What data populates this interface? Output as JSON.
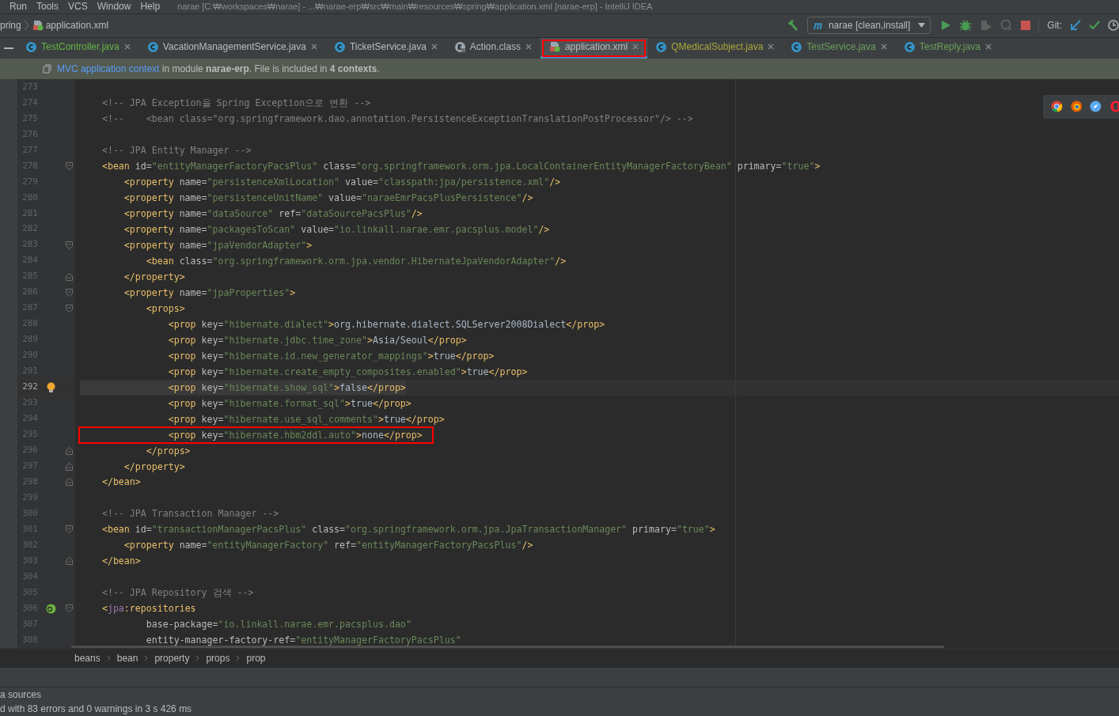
{
  "menu": [
    "Run",
    "Tools",
    "VCS",
    "Window",
    "Help"
  ],
  "window": {
    "title": "narae [C:₩workspaces₩narae] - ...₩narae-erp₩src₩main₩resources₩spring₩application.xml [narae-erp] - IntelliJ IDEA"
  },
  "breadcrumb": {
    "folder": "pring",
    "file": "application.xml"
  },
  "toolbar": {
    "run_config": "narae [clean,install]",
    "git_label": "Git:"
  },
  "tabs": [
    {
      "label": "TestController.java",
      "kind": "class",
      "color": "#62b543",
      "selected": false,
      "highlighted": false
    },
    {
      "label": "VacationManagementService.java",
      "kind": "class",
      "color": "#bbbbbb",
      "selected": false,
      "highlighted": false
    },
    {
      "label": "TicketService.java",
      "kind": "class",
      "color": "#bbbbbb",
      "selected": false,
      "highlighted": false
    },
    {
      "label": "Action.class",
      "kind": "enum",
      "color": "#bbbbbb",
      "selected": false,
      "highlighted": false
    },
    {
      "label": "application.xml",
      "kind": "xml",
      "color": "#bbbbbb",
      "selected": true,
      "highlighted": true
    },
    {
      "label": "QMedicalSubject.java",
      "kind": "class",
      "color": "#a8a83a",
      "selected": false,
      "highlighted": false
    },
    {
      "label": "TestService.java",
      "kind": "class",
      "color": "#6a9f5b",
      "selected": false,
      "highlighted": false
    },
    {
      "label": "TestReply.java",
      "kind": "class",
      "color": "#6a9f5b",
      "selected": false,
      "highlighted": false
    }
  ],
  "notice": {
    "link": "MVC application context",
    "text": " in module **narae-erp**. File is included in **4 contexts**."
  },
  "editor": {
    "lines": [
      {
        "number": "273"
      },
      {
        "number": "274",
        "segments": [
          {
            "kind": "comment",
            "text": "    <!-- JPA Exception을 Spring Exception으로 변환 -->"
          }
        ]
      },
      {
        "number": "275",
        "segments": [
          {
            "kind": "comment",
            "text": "    <!--    <bean class=\"org.springframework.dao.annotation.PersistenceExceptionTranslationPostProcessor\"/> -->"
          }
        ]
      },
      {
        "number": "276"
      },
      {
        "number": "277",
        "segments": [
          {
            "kind": "comment",
            "text": "    <!-- JPA Entity Manager -->"
          }
        ]
      },
      {
        "number": "278",
        "fold_start": true,
        "segments": [
          {
            "kind": "tag",
            "text": "    <bean "
          },
          {
            "kind": "attr",
            "text": "id="
          },
          {
            "kind": "value",
            "text": "\"entityManagerFactoryPacsPlus\""
          },
          {
            "kind": "attr",
            "text": " class="
          },
          {
            "kind": "value",
            "text": "\"org.springframework.orm.jpa.LocalContainerEntityManagerFactoryBean\""
          },
          {
            "kind": "attr",
            "text": " primary="
          },
          {
            "kind": "value",
            "text": "\"true\""
          },
          {
            "kind": "tag",
            "text": ">"
          }
        ]
      },
      {
        "number": "279",
        "segments": [
          {
            "kind": "tag",
            "text": "        <property "
          },
          {
            "kind": "attr",
            "text": "name="
          },
          {
            "kind": "value",
            "text": "\"persistenceXmlLocation\""
          },
          {
            "kind": "attr",
            "text": " value="
          },
          {
            "kind": "value",
            "text": "\"classpath:jpa/persistence.xml\""
          },
          {
            "kind": "tag",
            "text": "/>"
          }
        ]
      },
      {
        "number": "280",
        "segments": [
          {
            "kind": "tag",
            "text": "        <property "
          },
          {
            "kind": "attr",
            "text": "name="
          },
          {
            "kind": "value",
            "text": "\"persistenceUnitName\""
          },
          {
            "kind": "attr",
            "text": " value="
          },
          {
            "kind": "value",
            "text": "\"naraeEmrPacsPlusPersistence\""
          },
          {
            "kind": "tag",
            "text": "/>"
          }
        ]
      },
      {
        "number": "281",
        "segments": [
          {
            "kind": "tag",
            "text": "        <property "
          },
          {
            "kind": "attr",
            "text": "name="
          },
          {
            "kind": "value",
            "text": "\"dataSource\""
          },
          {
            "kind": "attr",
            "text": " ref="
          },
          {
            "kind": "value",
            "text": "\"dataSourcePacsPlus\""
          },
          {
            "kind": "tag",
            "text": "/>"
          }
        ]
      },
      {
        "number": "282",
        "segments": [
          {
            "kind": "tag",
            "text": "        <property "
          },
          {
            "kind": "attr",
            "text": "name="
          },
          {
            "kind": "value",
            "text": "\"packagesToScan\""
          },
          {
            "kind": "attr",
            "text": " value="
          },
          {
            "kind": "value",
            "text": "\"io.linkall.narae.emr.pacsplus.model\""
          },
          {
            "kind": "tag",
            "text": "/>"
          }
        ]
      },
      {
        "number": "283",
        "fold_start": true,
        "segments": [
          {
            "kind": "tag",
            "text": "        <property "
          },
          {
            "kind": "attr",
            "text": "name="
          },
          {
            "kind": "value",
            "text": "\"jpaVendorAdapter\""
          },
          {
            "kind": "tag",
            "text": ">"
          }
        ]
      },
      {
        "number": "284",
        "segments": [
          {
            "kind": "tag",
            "text": "            <bean "
          },
          {
            "kind": "attr",
            "text": "class="
          },
          {
            "kind": "value",
            "text": "\"org.springframework.orm.jpa.vendor.HibernateJpaVendorAdapter\""
          },
          {
            "kind": "tag",
            "text": "/>"
          }
        ]
      },
      {
        "number": "285",
        "fold_end": true,
        "segments": [
          {
            "kind": "tag",
            "text": "        </property>"
          }
        ]
      },
      {
        "number": "286",
        "fold_start": true,
        "segments": [
          {
            "kind": "tag",
            "text": "        <property "
          },
          {
            "kind": "attr",
            "text": "name="
          },
          {
            "kind": "value",
            "text": "\"jpaProperties\""
          },
          {
            "kind": "tag",
            "text": ">"
          }
        ]
      },
      {
        "number": "287",
        "fold_start": true,
        "segments": [
          {
            "kind": "tag",
            "text": "            <props>"
          }
        ]
      },
      {
        "number": "288",
        "segments": [
          {
            "kind": "tag",
            "text": "                <prop "
          },
          {
            "kind": "attr",
            "text": "key="
          },
          {
            "kind": "value",
            "text": "\"hibernate.dialect\""
          },
          {
            "kind": "tag",
            "text": ">"
          },
          {
            "kind": "plain",
            "text": "org.hibernate.dialect.SQLServer2008Dialect"
          },
          {
            "kind": "tag",
            "text": "</prop>"
          }
        ]
      },
      {
        "number": "289",
        "segments": [
          {
            "kind": "tag",
            "text": "                <prop "
          },
          {
            "kind": "attr",
            "text": "key="
          },
          {
            "kind": "value",
            "text": "\"hibernate.jdbc.time_zone\""
          },
          {
            "kind": "tag",
            "text": ">"
          },
          {
            "kind": "plain",
            "text": "Asia/Seoul"
          },
          {
            "kind": "tag",
            "text": "</prop>"
          }
        ]
      },
      {
        "number": "290",
        "segments": [
          {
            "kind": "tag",
            "text": "                <prop "
          },
          {
            "kind": "attr",
            "text": "key="
          },
          {
            "kind": "value",
            "text": "\"hibernate.id.new_generator_mappings\""
          },
          {
            "kind": "tag",
            "text": ">"
          },
          {
            "kind": "plain",
            "text": "true"
          },
          {
            "kind": "tag",
            "text": "</prop>"
          }
        ]
      },
      {
        "number": "291",
        "segments": [
          {
            "kind": "tag",
            "text": "                <prop "
          },
          {
            "kind": "attr",
            "text": "key="
          },
          {
            "kind": "value",
            "text": "\"hibernate.create_empty_composites.enabled\""
          },
          {
            "kind": "tag",
            "text": ">"
          },
          {
            "kind": "plain",
            "text": "true"
          },
          {
            "kind": "tag",
            "text": "</prop>"
          }
        ]
      },
      {
        "number": "292",
        "current": true,
        "bulb": true,
        "segments": [
          {
            "kind": "tag",
            "text": "                <prop "
          },
          {
            "kind": "attr",
            "text": "key="
          },
          {
            "kind": "value",
            "text": "\"hibernate.show_sql\""
          },
          {
            "kind": "tag",
            "text": ">"
          },
          {
            "kind": "plain",
            "text": "false"
          },
          {
            "kind": "tag",
            "text": "</prop>"
          }
        ]
      },
      {
        "number": "293",
        "segments": [
          {
            "kind": "tag",
            "text": "                <prop "
          },
          {
            "kind": "attr",
            "text": "key="
          },
          {
            "kind": "value",
            "text": "\"hibernate.format_sql\""
          },
          {
            "kind": "tag",
            "text": ">"
          },
          {
            "kind": "plain",
            "text": "true"
          },
          {
            "kind": "tag",
            "text": "</prop>"
          }
        ]
      },
      {
        "number": "294",
        "segments": [
          {
            "kind": "tag",
            "text": "                <prop "
          },
          {
            "kind": "attr",
            "text": "key="
          },
          {
            "kind": "value",
            "text": "\"hibernate.use_sql_comments\""
          },
          {
            "kind": "tag",
            "text": ">"
          },
          {
            "kind": "plain",
            "text": "true"
          },
          {
            "kind": "tag",
            "text": "</prop>"
          }
        ]
      },
      {
        "number": "295",
        "highlighted": true,
        "segments": [
          {
            "kind": "tag",
            "text": "                <prop "
          },
          {
            "kind": "attr",
            "text": "key="
          },
          {
            "kind": "value",
            "text": "\"hibernate.hbm2ddl.auto\""
          },
          {
            "kind": "tag",
            "text": ">"
          },
          {
            "kind": "plain",
            "text": "none"
          },
          {
            "kind": "tag",
            "text": "</prop>"
          }
        ]
      },
      {
        "number": "296",
        "fold_end": true,
        "segments": [
          {
            "kind": "tag",
            "text": "            </props>"
          }
        ]
      },
      {
        "number": "297",
        "fold_end": true,
        "segments": [
          {
            "kind": "tag",
            "text": "        </property>"
          }
        ]
      },
      {
        "number": "298",
        "fold_end": true,
        "segments": [
          {
            "kind": "tag",
            "text": "    </bean>"
          }
        ]
      },
      {
        "number": "299"
      },
      {
        "number": "300",
        "segments": [
          {
            "kind": "comment",
            "text": "    <!-- JPA Transaction Manager -->"
          }
        ]
      },
      {
        "number": "301",
        "fold_start": true,
        "segments": [
          {
            "kind": "tag",
            "text": "    <bean "
          },
          {
            "kind": "attr",
            "text": "id="
          },
          {
            "kind": "value",
            "text": "\"transactionManagerPacsPlus\""
          },
          {
            "kind": "attr",
            "text": " class="
          },
          {
            "kind": "value",
            "text": "\"org.springframework.orm.jpa.JpaTransactionManager\""
          },
          {
            "kind": "attr",
            "text": " primary="
          },
          {
            "kind": "value",
            "text": "\"true\""
          },
          {
            "kind": "tag",
            "text": ">"
          }
        ]
      },
      {
        "number": "302",
        "segments": [
          {
            "kind": "tag",
            "text": "        <property "
          },
          {
            "kind": "attr",
            "text": "name="
          },
          {
            "kind": "value",
            "text": "\"entityManagerFactory\""
          },
          {
            "kind": "attr",
            "text": " ref="
          },
          {
            "kind": "value",
            "text": "\"entityManagerFactoryPacsPlus\""
          },
          {
            "kind": "tag",
            "text": "/>"
          }
        ]
      },
      {
        "number": "303",
        "fold_end": true,
        "segments": [
          {
            "kind": "tag",
            "text": "    </bean>"
          }
        ]
      },
      {
        "number": "304"
      },
      {
        "number": "305",
        "segments": [
          {
            "kind": "comment",
            "text": "    <!-- JPA Repository 검색 -->"
          }
        ]
      },
      {
        "number": "306",
        "fold_start": true,
        "repo": true,
        "segments": [
          {
            "kind": "tag",
            "text": "    <"
          },
          {
            "kind": "ns",
            "text": "jpa"
          },
          {
            "kind": "tag",
            "text": ":repositories"
          }
        ]
      },
      {
        "number": "307",
        "segments": [
          {
            "kind": "attr",
            "text": "            base-package="
          },
          {
            "kind": "value",
            "text": "\"io.linkall.narae.emr.pacsplus.dao\""
          }
        ]
      },
      {
        "number": "308",
        "segments": [
          {
            "kind": "attr",
            "text": "            entity-manager-factory-ref="
          },
          {
            "kind": "value",
            "text": "\"entityManagerFactoryPacsPlus\""
          }
        ]
      }
    ]
  },
  "path": [
    "beans",
    "bean",
    "property",
    "props",
    "prop"
  ],
  "output": [
    "a sources",
    "d with 83 errors and 0 warnings in 3 s 426 ms"
  ]
}
